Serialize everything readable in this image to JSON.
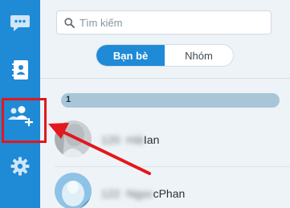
{
  "search": {
    "placeholder": "Tìm kiếm"
  },
  "tabs": [
    {
      "label": "Bạn bè",
      "active": true
    },
    {
      "label": "Nhóm",
      "active": false
    }
  ],
  "group": {
    "label": "1"
  },
  "contacts": [
    {
      "blurred_prefix": "120 ·Hải",
      "name_tail": "Ian"
    },
    {
      "blurred_prefix": "122 ·Ngọc",
      "name_tail": "cPhan"
    }
  ],
  "sidebar": {
    "icons": [
      "chat-icon",
      "contacts-book-icon",
      "add-friend-icon",
      "gear-icon"
    ]
  },
  "colors": {
    "rail": "#1f8ad6",
    "accent": "#1f8ad6",
    "highlight": "#e3171d"
  }
}
